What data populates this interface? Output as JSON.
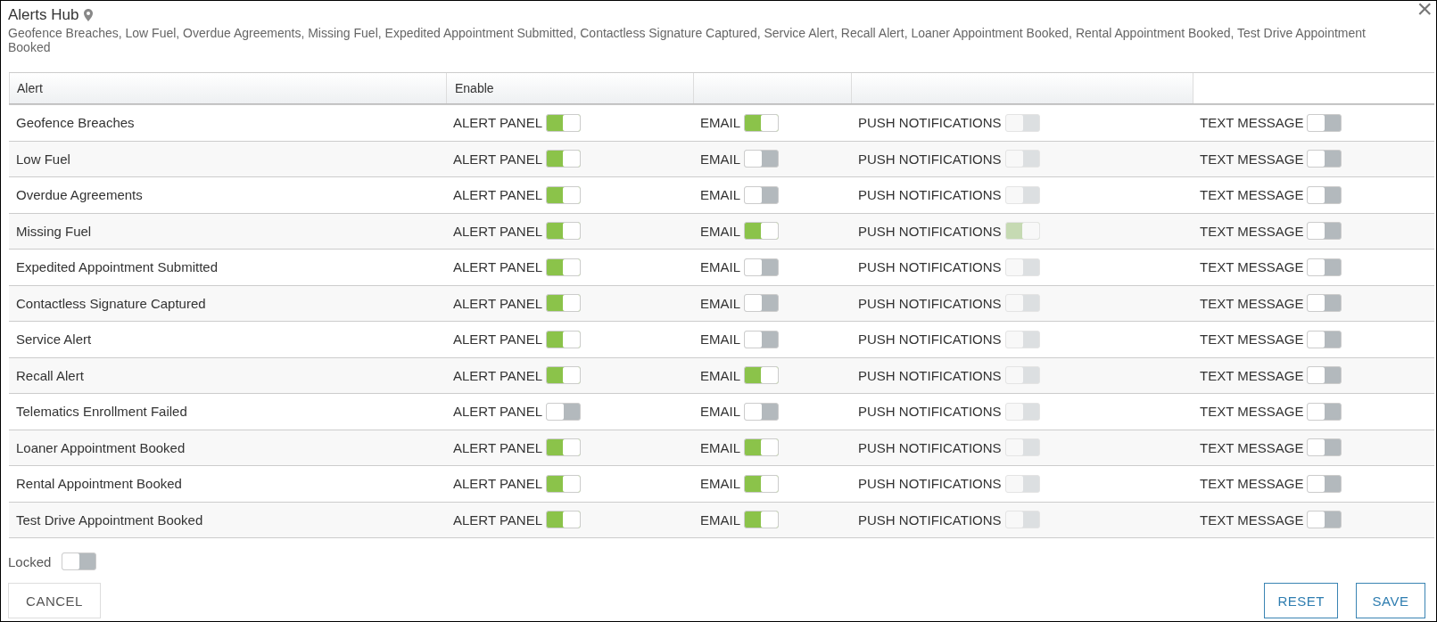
{
  "dialog": {
    "title": "Alerts Hub",
    "close": "×",
    "subtitle": "Geofence Breaches, Low Fuel, Overdue Agreements, Missing Fuel, Expedited Appointment Submitted, Contactless Signature Captured, Service Alert, Recall Alert, Loaner Appointment Booked, Rental Appointment Booked, Test Drive Appointment Booked"
  },
  "table": {
    "columns": [
      "Alert",
      "Enable"
    ],
    "rows": [
      {
        "name": "Geofence Breaches",
        "channels": [
          {
            "label": "ALERT PANEL",
            "on": true,
            "disabled": false
          },
          {
            "label": "EMAIL",
            "on": true,
            "disabled": false
          },
          {
            "label": "PUSH NOTIFICATIONS",
            "on": false,
            "disabled": true
          },
          {
            "label": "TEXT MESSAGE",
            "on": false,
            "disabled": false
          }
        ]
      },
      {
        "name": "Low Fuel",
        "channels": [
          {
            "label": "ALERT PANEL",
            "on": true,
            "disabled": false
          },
          {
            "label": "EMAIL",
            "on": false,
            "disabled": false
          },
          {
            "label": "PUSH NOTIFICATIONS",
            "on": false,
            "disabled": true
          },
          {
            "label": "TEXT MESSAGE",
            "on": false,
            "disabled": false
          }
        ]
      },
      {
        "name": "Overdue Agreements",
        "channels": [
          {
            "label": "ALERT PANEL",
            "on": true,
            "disabled": false
          },
          {
            "label": "EMAIL",
            "on": false,
            "disabled": false
          },
          {
            "label": "PUSH NOTIFICATIONS",
            "on": false,
            "disabled": true
          },
          {
            "label": "TEXT MESSAGE",
            "on": false,
            "disabled": false
          }
        ]
      },
      {
        "name": "Missing Fuel",
        "channels": [
          {
            "label": "ALERT PANEL",
            "on": true,
            "disabled": false
          },
          {
            "label": "EMAIL",
            "on": true,
            "disabled": false
          },
          {
            "label": "PUSH NOTIFICATIONS",
            "on": true,
            "disabled": true
          },
          {
            "label": "TEXT MESSAGE",
            "on": false,
            "disabled": false
          }
        ]
      },
      {
        "name": "Expedited Appointment Submitted",
        "channels": [
          {
            "label": "ALERT PANEL",
            "on": true,
            "disabled": false
          },
          {
            "label": "EMAIL",
            "on": false,
            "disabled": false
          },
          {
            "label": "PUSH NOTIFICATIONS",
            "on": false,
            "disabled": true
          },
          {
            "label": "TEXT MESSAGE",
            "on": false,
            "disabled": false
          }
        ]
      },
      {
        "name": "Contactless Signature Captured",
        "channels": [
          {
            "label": "ALERT PANEL",
            "on": true,
            "disabled": false
          },
          {
            "label": "EMAIL",
            "on": false,
            "disabled": false
          },
          {
            "label": "PUSH NOTIFICATIONS",
            "on": false,
            "disabled": true
          },
          {
            "label": "TEXT MESSAGE",
            "on": false,
            "disabled": false
          }
        ]
      },
      {
        "name": "Service Alert",
        "channels": [
          {
            "label": "ALERT PANEL",
            "on": true,
            "disabled": false
          },
          {
            "label": "EMAIL",
            "on": false,
            "disabled": false
          },
          {
            "label": "PUSH NOTIFICATIONS",
            "on": false,
            "disabled": true
          },
          {
            "label": "TEXT MESSAGE",
            "on": false,
            "disabled": false
          }
        ]
      },
      {
        "name": "Recall Alert",
        "channels": [
          {
            "label": "ALERT PANEL",
            "on": true,
            "disabled": false
          },
          {
            "label": "EMAIL",
            "on": true,
            "disabled": false
          },
          {
            "label": "PUSH NOTIFICATIONS",
            "on": false,
            "disabled": true
          },
          {
            "label": "TEXT MESSAGE",
            "on": false,
            "disabled": false
          }
        ]
      },
      {
        "name": "Telematics Enrollment Failed",
        "channels": [
          {
            "label": "ALERT PANEL",
            "on": false,
            "disabled": false
          },
          {
            "label": "EMAIL",
            "on": false,
            "disabled": false
          },
          {
            "label": "PUSH NOTIFICATIONS",
            "on": false,
            "disabled": true
          },
          {
            "label": "TEXT MESSAGE",
            "on": false,
            "disabled": false
          }
        ]
      },
      {
        "name": "Loaner Appointment Booked",
        "channels": [
          {
            "label": "ALERT PANEL",
            "on": true,
            "disabled": false
          },
          {
            "label": "EMAIL",
            "on": true,
            "disabled": false
          },
          {
            "label": "PUSH NOTIFICATIONS",
            "on": false,
            "disabled": true
          },
          {
            "label": "TEXT MESSAGE",
            "on": false,
            "disabled": false
          }
        ]
      },
      {
        "name": "Rental Appointment Booked",
        "channels": [
          {
            "label": "ALERT PANEL",
            "on": true,
            "disabled": false
          },
          {
            "label": "EMAIL",
            "on": true,
            "disabled": false
          },
          {
            "label": "PUSH NOTIFICATIONS",
            "on": false,
            "disabled": true
          },
          {
            "label": "TEXT MESSAGE",
            "on": false,
            "disabled": false
          }
        ]
      },
      {
        "name": "Test Drive Appointment Booked",
        "channels": [
          {
            "label": "ALERT PANEL",
            "on": true,
            "disabled": false
          },
          {
            "label": "EMAIL",
            "on": true,
            "disabled": false
          },
          {
            "label": "PUSH NOTIFICATIONS",
            "on": false,
            "disabled": true
          },
          {
            "label": "TEXT MESSAGE",
            "on": false,
            "disabled": false
          }
        ]
      }
    ]
  },
  "locked": {
    "label": "Locked",
    "on": false,
    "disabled": false
  },
  "buttons": {
    "cancel": "CANCEL",
    "reset": "RESET",
    "save": "SAVE"
  }
}
